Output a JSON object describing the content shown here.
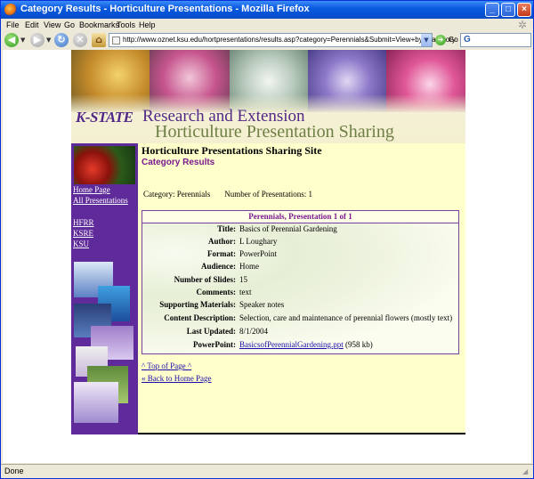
{
  "window": {
    "title": "Category Results - Horticulture Presentations - Mozilla Firefox",
    "min_glyph": "_",
    "max_glyph": "□",
    "close_glyph": "×"
  },
  "menu": {
    "items": [
      "File",
      "Edit",
      "View",
      "Go",
      "Bookmarks",
      "Tools",
      "Help"
    ]
  },
  "toolbar": {
    "url": "http://www.oznet.ksu.edu/hortpresentations/results.asp?category=Perennials&Submit=View+by+Category",
    "go_label": "Go",
    "search_value": "G"
  },
  "banner": {
    "logo_text": "K-STATE",
    "line1": "Research and Extension",
    "line2": "Horticulture Presentation Sharing"
  },
  "sidebar": {
    "links": [
      "Home Page",
      "All Presentations",
      "HFRR",
      "KSRE",
      "KSU"
    ]
  },
  "main": {
    "site_title": "Horticulture Presentations Sharing Site",
    "page_title": "Category Results",
    "category_label": "Category:",
    "category_value": "Perennials",
    "count_label": "Number of Presentations:",
    "count_value": "1"
  },
  "detail": {
    "heading": "Perennials, Presentation 1 of 1",
    "rows": [
      {
        "label": "Title:",
        "value": "Basics of Perennial Gardening"
      },
      {
        "label": "Author:",
        "value": "L Loughary"
      },
      {
        "label": "Format:",
        "value": "PowerPoint"
      },
      {
        "label": "Audience:",
        "value": "Home"
      },
      {
        "label": "Number of Slides:",
        "value": "15"
      },
      {
        "label": "Comments:",
        "value": "text"
      },
      {
        "label": "Supporting Materials:",
        "value": "Speaker notes"
      },
      {
        "label": "Content Description:",
        "value": "Selection, care and maintenance of perennial flowers (mostly text)"
      },
      {
        "label": "Last Updated:",
        "value": "8/1/2004"
      },
      {
        "label": "PowerPoint:",
        "file": "BasicsofPerennialGardening.ppt",
        "size": "(958 kb)"
      }
    ]
  },
  "footer_links": {
    "top": "^ Top of Page ^",
    "home": "« Back to Home Page"
  },
  "status": {
    "text": "Done"
  },
  "colors": {
    "titlebar": "#0A5BE0",
    "sidebar": "#5F2A99",
    "page_bg": "#FFFFCC",
    "heading_purple": "#7A1A8E"
  }
}
